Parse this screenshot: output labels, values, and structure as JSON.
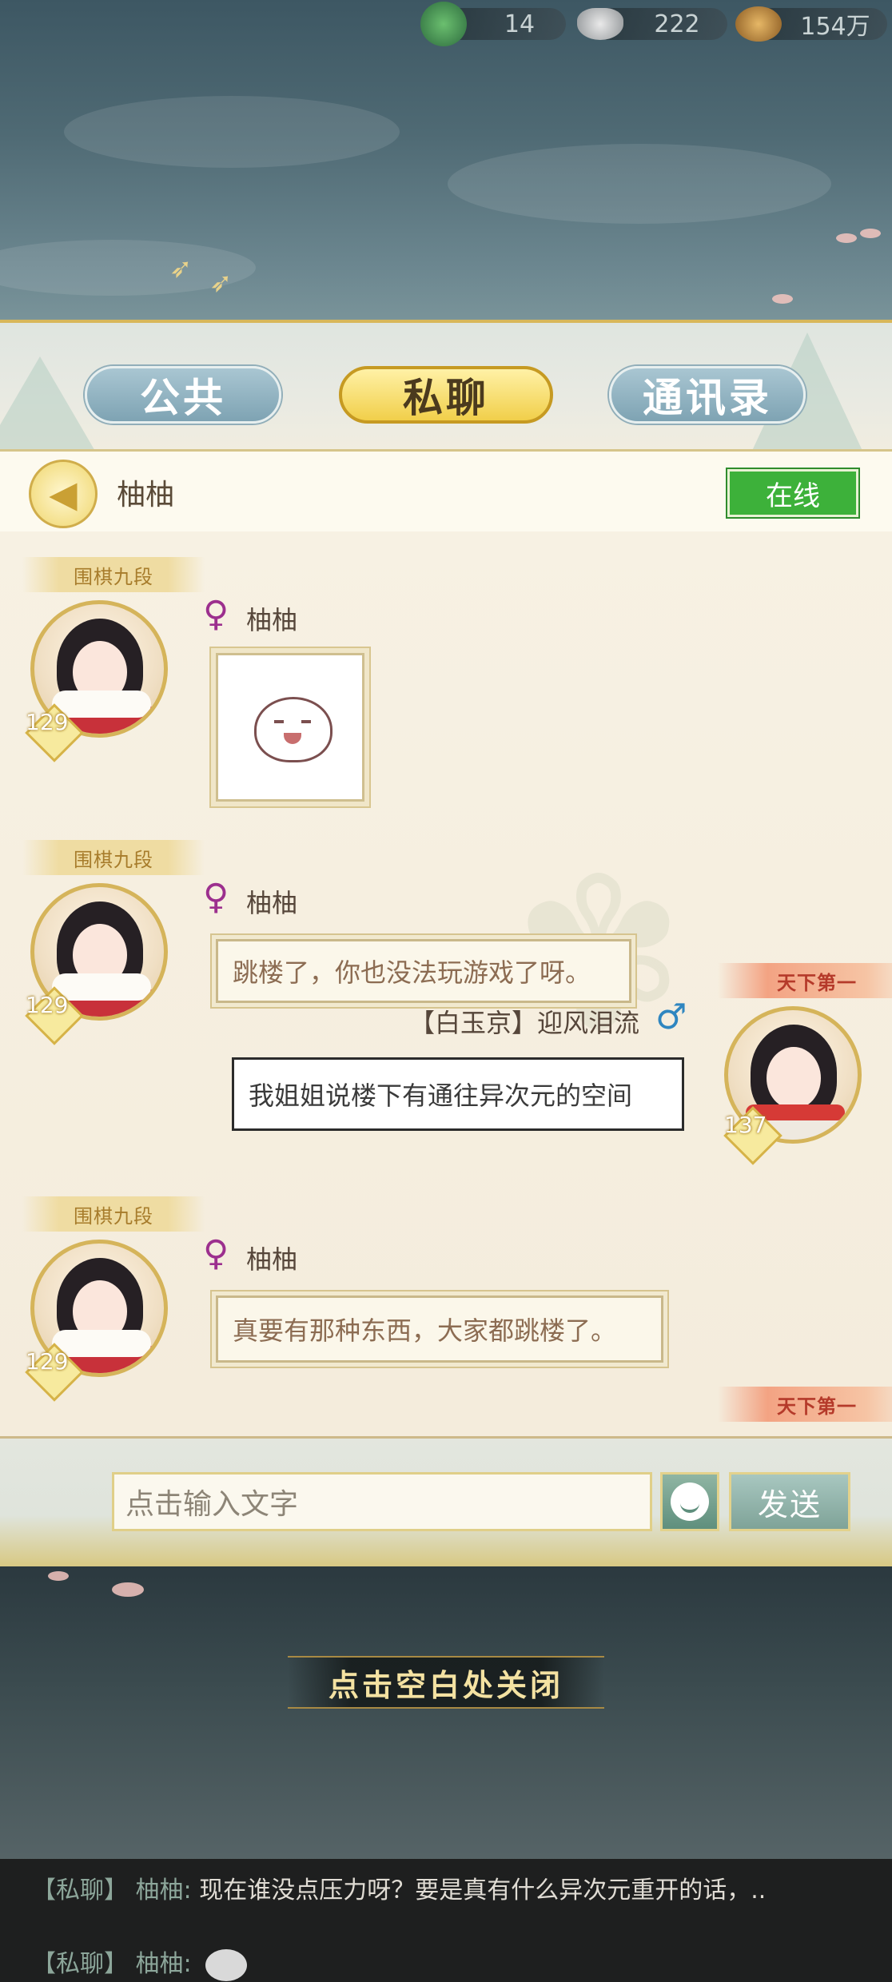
{
  "currency": {
    "jade": "14",
    "silver": "222",
    "coins": "154万"
  },
  "tabs": [
    {
      "label": "公共",
      "active": false
    },
    {
      "label": "私聊",
      "active": true
    },
    {
      "label": "通讯录",
      "active": false
    }
  ],
  "chat_header": {
    "back_icon": "chevron-left-icon",
    "contact_name": "柚柚",
    "status": "在线"
  },
  "messages": [
    {
      "side": "left",
      "title": "围棋九段",
      "level": "129",
      "gender": "♀",
      "name": "柚柚",
      "type": "sticker"
    },
    {
      "side": "left",
      "title": "围棋九段",
      "level": "129",
      "gender": "♀",
      "name": "柚柚",
      "type": "text",
      "text": "跳楼了，你也没法玩游戏了呀。"
    },
    {
      "side": "right",
      "title": "天下第一",
      "level": "137",
      "gender": "♂",
      "name": "【白玉京】迎风泪流",
      "type": "text",
      "text": "我姐姐说楼下有通往异次元的空间"
    },
    {
      "side": "left",
      "title": "围棋九段",
      "level": "129",
      "gender": "♀",
      "name": "柚柚",
      "type": "text",
      "text": "真要有那种东西，大家都跳楼了。"
    }
  ],
  "bottom_badge": "天下第一",
  "input": {
    "placeholder": "点击输入文字",
    "send_label": "发送"
  },
  "close_hint": "点击空白处关闭",
  "ticker": [
    {
      "tag": "【私聊】",
      "sender": "柚柚:",
      "text": "现在谁没点压力呀？要是真有什么异次元重开的话，.."
    },
    {
      "tag": "【私聊】",
      "sender": "柚柚:",
      "text": ""
    }
  ],
  "colors": {
    "tab_active": "#f1cf4a",
    "tab_inactive": "#7ea3b3",
    "online": "#3db13a",
    "female": "#9c2f8e",
    "male": "#2f86c0"
  }
}
